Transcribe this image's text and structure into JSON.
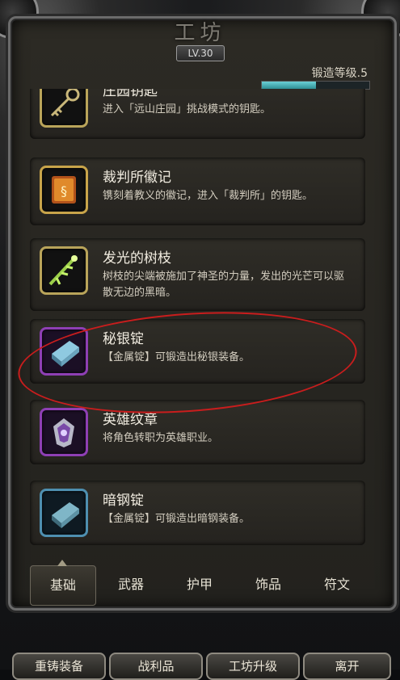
{
  "header": {
    "title": "工坊",
    "level_badge": "LV.30",
    "forge_level_label": "锻造等级.5",
    "forge_progress": 0.5
  },
  "items": [
    {
      "name": "庄园钥匙",
      "desc": "进入「远山庄园」挑战模式的钥匙。",
      "icon": "key-icon",
      "frame_color": "#b9a45a"
    },
    {
      "name": "裁判所徽记",
      "desc": "镌刻着教义的徽记，进入「裁判所」的钥匙。",
      "icon": "emblem-icon",
      "frame_color": "#c8a44a"
    },
    {
      "name": "发光的树枝",
      "desc": "树枝的尖端被施加了神圣的力量，发出的光芒可以驱散无边的黑暗。",
      "icon": "branch-icon",
      "frame_color": "#b9a45a"
    },
    {
      "name": "秘银锭",
      "desc": "【金属锭】可锻造出秘银装备。",
      "icon": "mithril-ingot-icon",
      "frame_color": "#8e3fb4"
    },
    {
      "name": "英雄纹章",
      "desc": "将角色转职为英雄职业。",
      "icon": "hero-crest-icon",
      "frame_color": "#8e3fb4"
    },
    {
      "name": "暗钢锭",
      "desc": "【金属锭】可锻造出暗钢装备。",
      "icon": "darksteel-ingot-icon",
      "frame_color": "#4e8fb0"
    }
  ],
  "tabs": [
    "基础",
    "武器",
    "护甲",
    "饰品",
    "符文"
  ],
  "active_tab": "基础",
  "bottom_buttons": [
    "重铸装备",
    "战利品",
    "工坊升级",
    "离开"
  ]
}
